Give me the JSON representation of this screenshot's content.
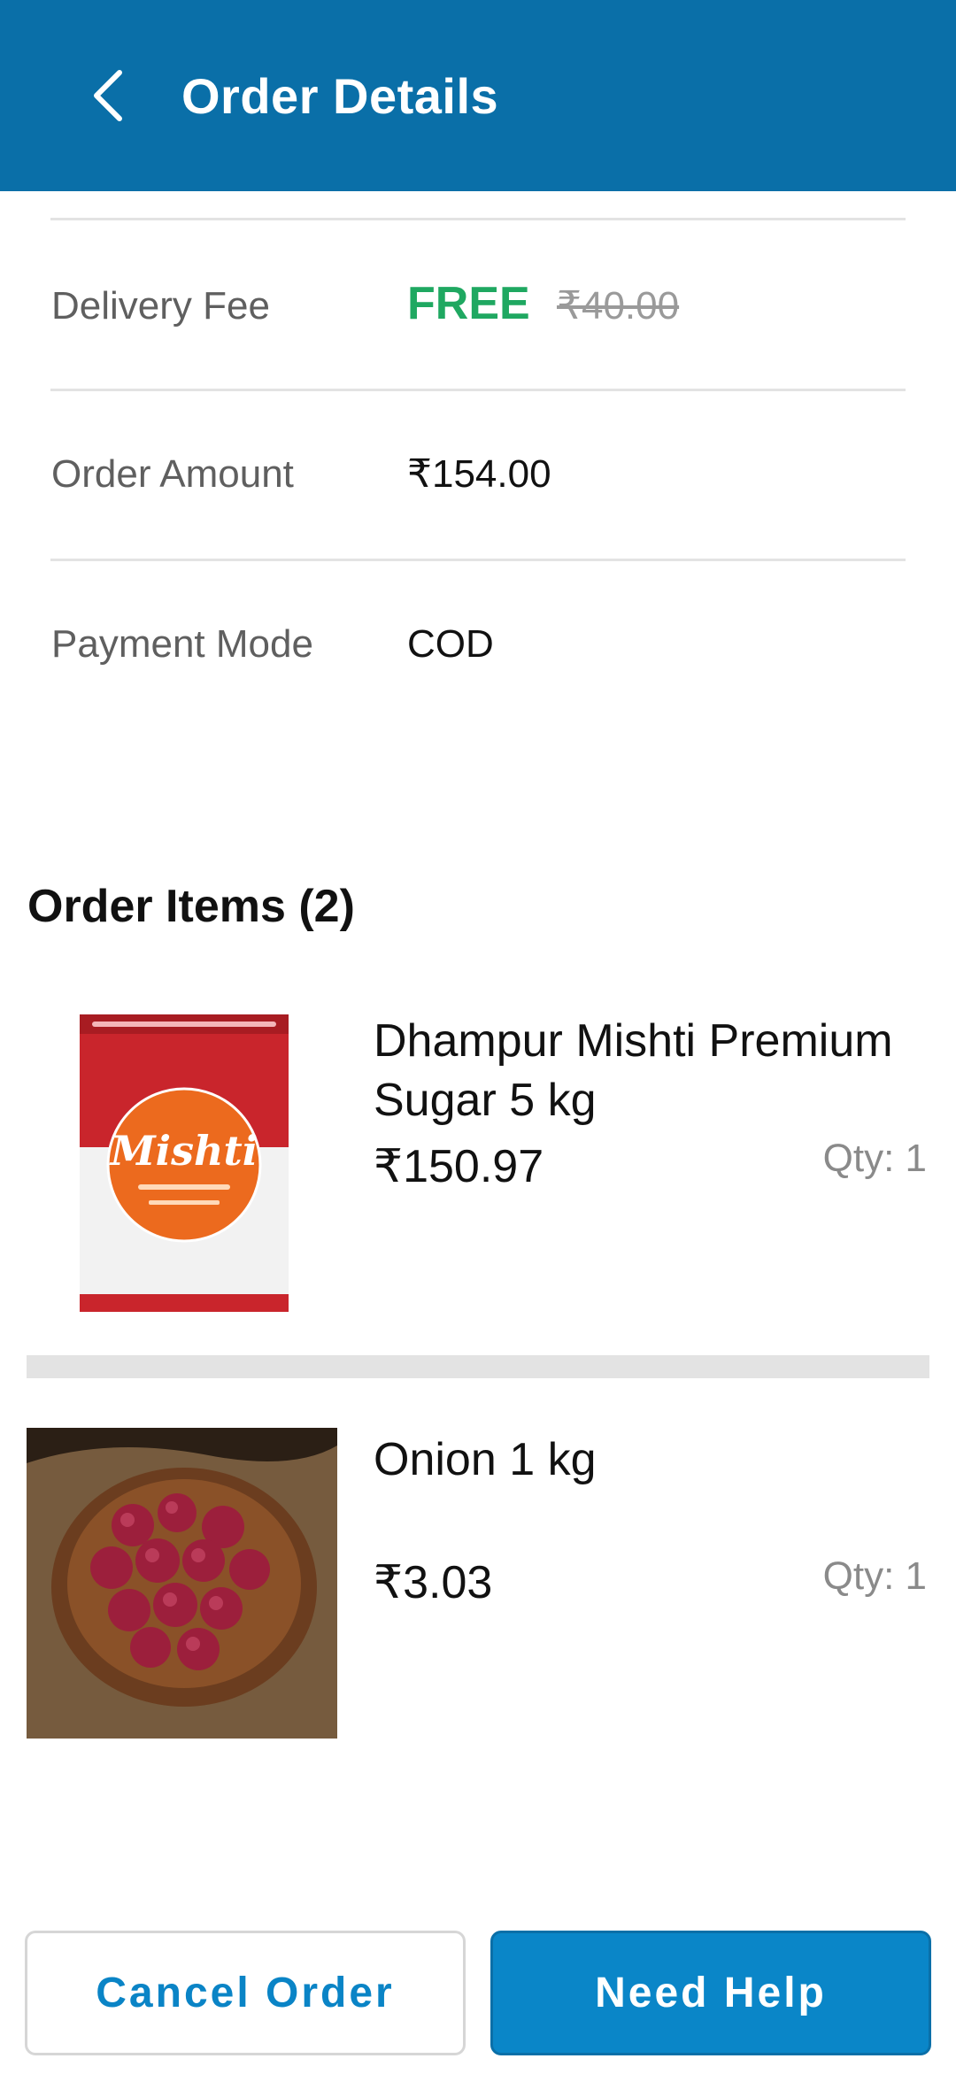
{
  "header": {
    "title": "Order Details",
    "back_icon": "chevron-left-icon",
    "background_color": "#0a6fa8"
  },
  "summary": {
    "delivery_fee": {
      "label": "Delivery Fee",
      "value": "FREE",
      "original": "₹40.00",
      "value_color": "#1fa861"
    },
    "order_amount": {
      "label": "Order Amount",
      "value": "₹154.00"
    },
    "payment_mode": {
      "label": "Payment Mode",
      "value": "COD"
    }
  },
  "items_section": {
    "heading": "Order Items (2)",
    "items": [
      {
        "name": "Dhampur Mishti Premium Sugar 5 kg",
        "price": "₹150.97",
        "qty": "Qty: 1",
        "image": "sugar-pack-image",
        "brand_logo": "Mishti"
      },
      {
        "name": "Onion 1 kg",
        "price": "₹3.03",
        "qty": "Qty: 1",
        "image": "onions-bowl-image"
      }
    ]
  },
  "actions": {
    "cancel_label": "Cancel Order",
    "help_label": "Need Help",
    "accent_color": "#0a86c8"
  }
}
